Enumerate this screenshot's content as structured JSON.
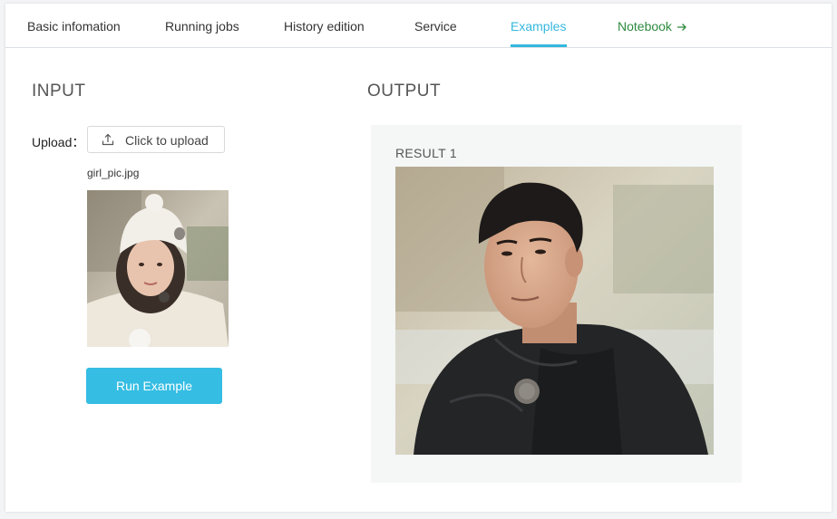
{
  "tabs": {
    "basic": "Basic infomation",
    "running": "Running jobs",
    "history": "History edition",
    "service": "Service",
    "examples": "Examples",
    "notebook": "Notebook",
    "active": "Examples"
  },
  "input": {
    "title": "INPUT",
    "upload_label": "Upload：",
    "upload_button": "Click to upload",
    "file_name": "girl_pic.jpg",
    "photo_icon": "photo-of-woman-in-white-knit-hat",
    "run_button": "Run Example"
  },
  "output": {
    "title": "OUTPUT",
    "result_label": "RESULT 1",
    "photo_icon": "photo-of-man-in-black-jacket"
  },
  "colors": {
    "accent": "#35b8de",
    "run_button": "#35bde3",
    "notebook_link": "#2e8b3e",
    "output_bg": "#f4f7f6"
  }
}
